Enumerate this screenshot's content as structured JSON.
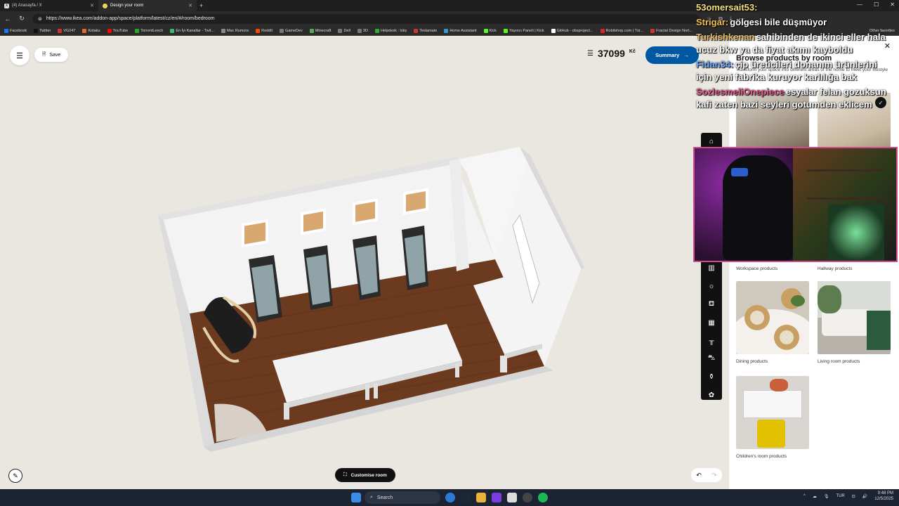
{
  "browser": {
    "tabs": [
      {
        "label": "(4) Anasayfa / X",
        "icon": "x-icon"
      },
      {
        "label": "Design your room",
        "icon": "ikea-icon"
      }
    ],
    "url": "https://www.ikea.com/addon-app/space/platform/latest/cz/en/#/room/bedroom",
    "bookmarks": [
      "Facebook",
      "Twitter",
      "VG247",
      "Kotaku",
      "YouTube",
      "TorrentLeech",
      "En İyi Kanallar - Twit...",
      "Mac Rumors",
      "Reddit",
      "GameDev",
      "Minecraft",
      "Dell",
      "3D",
      "Helpdesk : loky",
      "Teslamate",
      "Home Assistant",
      "Kick",
      "Yayıncı Paneli | Kick",
      "GitHub - obsproject...",
      "Robitshop.com | Tür...",
      "Fractal Design Nort..."
    ],
    "bookmarks_other": "Other favorites"
  },
  "planner": {
    "save_label": "Save",
    "price": "37099",
    "currency": "Kč",
    "summary_label": "Summary",
    "customise_label": "Customise room"
  },
  "panel": {
    "title": "Browse products by room",
    "subtitle": "Transform your space into different areas of the home to meet your lifestyle needs",
    "tiles": [
      {
        "label": "Workspace products"
      },
      {
        "label": "Hallway products"
      },
      {
        "label": "Dining products"
      },
      {
        "label": "Living room products"
      },
      {
        "label": "Children's room products"
      }
    ]
  },
  "chat": [
    {
      "user": "53omersait53:",
      "text": "",
      "color": "#f5e27a"
    },
    {
      "user": "Strigar:",
      "text": "gölgesi bile düşmüyor",
      "color": "#f2c14e"
    },
    {
      "user": "Turkishkenan",
      "text": "sahibinden de ikinci eller hala ucuz bkw ya da fiyat akımı kayboldu",
      "color": "#e2b866"
    },
    {
      "user": "Fidan34:",
      "text": "çip üreticileri donanım ürünlerini için yeni fabrika kuruyor karlılığa bak",
      "color": "#6fa8ff"
    },
    {
      "user": "SozlesmeliOnepiece",
      "text": "esyalar felan gozuksun kafi zaten bazi seyleri gotumden eklicem",
      "color": "#e05a8a"
    }
  ],
  "taskbar": {
    "search_placeholder": "Search",
    "lang": "TUR",
    "time": "9:48 PM",
    "date": "12/5/2025"
  }
}
